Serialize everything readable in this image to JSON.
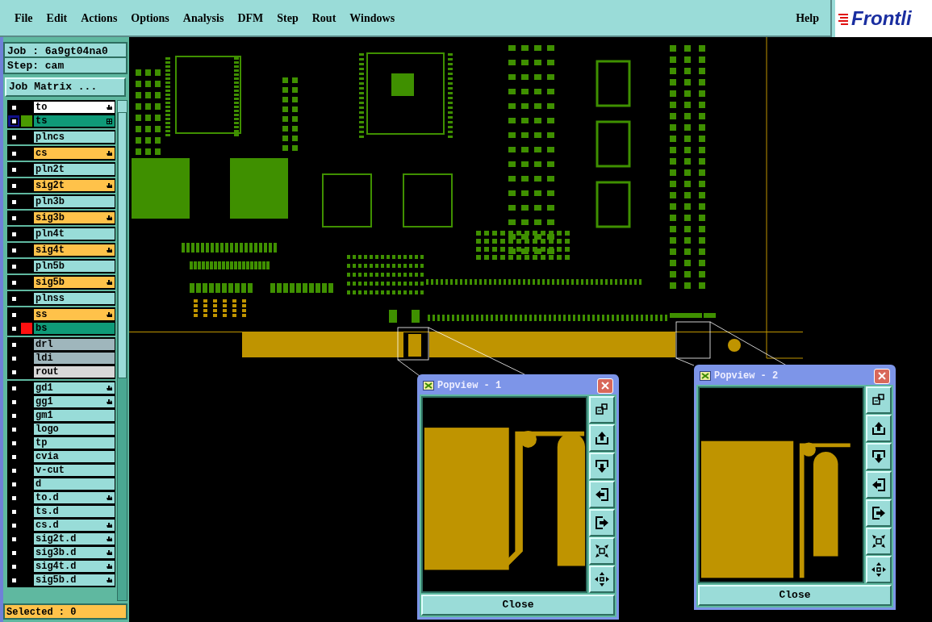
{
  "menu_bar": {
    "items": [
      "File",
      "Edit",
      "Actions",
      "Options",
      "Analysis",
      "DFM",
      "Step",
      "Rout",
      "Windows"
    ],
    "help": "Help",
    "logo": "Frontli"
  },
  "job_panel": {
    "job": "Job : 6a9gt04na0",
    "step": "Step: cam",
    "matrix_button": "Job Matrix ..."
  },
  "layer_groups": [
    [
      {
        "name": "to",
        "color": "#ffffff",
        "kind": "hand",
        "selected": false
      },
      {
        "name": "ts",
        "color": "#0f9a78",
        "kind": "grid",
        "selected": true,
        "swatch": {
          "color": "#4a9a00"
        }
      }
    ],
    [
      {
        "name": "plncs",
        "color": "#98dcd8",
        "kind": "plain",
        "selected": false
      }
    ],
    [
      {
        "name": "cs",
        "color": "#ffc24a",
        "kind": "hand",
        "selected": false
      }
    ],
    [
      {
        "name": "pln2t",
        "color": "#98dcd8",
        "kind": "plain",
        "selected": false
      }
    ],
    [
      {
        "name": "sig2t",
        "color": "#ffc24a",
        "kind": "hand",
        "selected": false
      }
    ],
    [
      {
        "name": "pln3b",
        "color": "#98dcd8",
        "kind": "plain",
        "selected": false
      }
    ],
    [
      {
        "name": "sig3b",
        "color": "#ffc24a",
        "kind": "hand",
        "selected": false
      }
    ],
    [
      {
        "name": "pln4t",
        "color": "#98dcd8",
        "kind": "plain",
        "selected": false
      }
    ],
    [
      {
        "name": "sig4t",
        "color": "#ffc24a",
        "kind": "hand",
        "selected": false
      }
    ],
    [
      {
        "name": "pln5b",
        "color": "#98dcd8",
        "kind": "plain",
        "selected": false
      }
    ],
    [
      {
        "name": "sig5b",
        "color": "#ffc24a",
        "kind": "hand",
        "selected": false
      }
    ],
    [
      {
        "name": "plnss",
        "color": "#98dcd8",
        "kind": "plain",
        "selected": false
      }
    ],
    [
      {
        "name": "ss",
        "color": "#ffc24a",
        "kind": "hand",
        "selected": false
      },
      {
        "name": "bs",
        "color": "#0f9a78",
        "kind": "plain",
        "selected": false,
        "swatch": {
          "color": "#ff1010"
        }
      }
    ],
    [
      {
        "name": "drl",
        "color": "#9fb6bc",
        "kind": "plain",
        "selected": false
      },
      {
        "name": "ldi",
        "color": "#9fb6bc",
        "kind": "plain",
        "selected": false
      },
      {
        "name": "rout",
        "color": "#d8d8d8",
        "kind": "plain",
        "selected": false
      }
    ],
    [
      {
        "name": "gd1",
        "color": "#98dcd8",
        "kind": "hand",
        "selected": false
      },
      {
        "name": "gg1",
        "color": "#98dcd8",
        "kind": "hand",
        "selected": false
      },
      {
        "name": "gm1",
        "color": "#98dcd8",
        "kind": "plain",
        "selected": false
      },
      {
        "name": "logo",
        "color": "#98dcd8",
        "kind": "plain",
        "selected": false
      },
      {
        "name": "tp",
        "color": "#98dcd8",
        "kind": "plain",
        "selected": false
      },
      {
        "name": "cvia",
        "color": "#98dcd8",
        "kind": "plain",
        "selected": false
      },
      {
        "name": "v-cut",
        "color": "#98dcd8",
        "kind": "plain",
        "selected": false
      },
      {
        "name": "d",
        "color": "#98dcd8",
        "kind": "plain",
        "selected": false
      },
      {
        "name": "to.d",
        "color": "#98dcd8",
        "kind": "hand",
        "selected": false
      },
      {
        "name": "ts.d",
        "color": "#98dcd8",
        "kind": "plain",
        "selected": false
      },
      {
        "name": "cs.d",
        "color": "#98dcd8",
        "kind": "hand",
        "selected": false
      },
      {
        "name": "sig2t.d",
        "color": "#98dcd8",
        "kind": "hand",
        "selected": false
      },
      {
        "name": "sig3b.d",
        "color": "#98dcd8",
        "kind": "hand",
        "selected": false
      },
      {
        "name": "sig4t.d",
        "color": "#98dcd8",
        "kind": "hand",
        "selected": false
      },
      {
        "name": "sig5b.d",
        "color": "#98dcd8",
        "kind": "hand",
        "selected": false
      }
    ]
  ],
  "selected_status": "Selected : 0",
  "popviews": [
    {
      "title": "Popview - 1",
      "close_button": "Close"
    },
    {
      "title": "Popview - 2",
      "close_button": "Close"
    }
  ]
}
